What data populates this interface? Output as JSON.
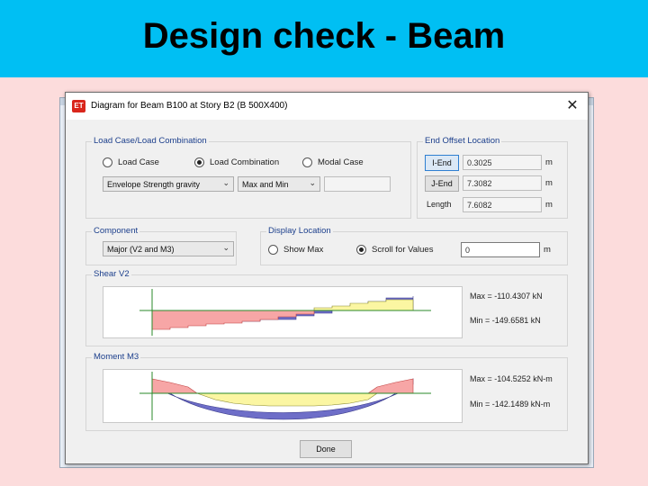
{
  "slide": {
    "title": "Design check - Beam"
  },
  "dialog": {
    "title": "Diagram for Beam B100 at Story B2 (B 500X400)",
    "load_case_group": {
      "label": "Load Case/Load Combination",
      "radios": [
        {
          "label": "Load Case",
          "selected": false
        },
        {
          "label": "Load Combination",
          "selected": true
        },
        {
          "label": "Modal Case",
          "selected": false
        }
      ],
      "combo_value": "Envelope Strength gravity",
      "type_value": "Max and Min",
      "extra_value": ""
    },
    "end_offset_group": {
      "label": "End Offset Location",
      "i_end": {
        "label": "I-End",
        "value": "0.3025",
        "unit": "m"
      },
      "j_end": {
        "label": "J-End",
        "value": "7.3082",
        "unit": "m"
      },
      "length": {
        "label": "Length",
        "value": "7.6082",
        "unit": "m"
      }
    },
    "component_group": {
      "label": "Component",
      "value": "Major (V2 and M3)"
    },
    "display_location_group": {
      "label": "Display Location",
      "radios": [
        {
          "label": "Show Max",
          "selected": false
        },
        {
          "label": "Scroll for Values",
          "selected": true
        }
      ],
      "value": "0",
      "unit": "m"
    },
    "shear": {
      "label": "Shear V2",
      "max": "Max = -110.4307 kN",
      "min": "Min = -149.6581 kN"
    },
    "moment": {
      "label": "Moment M3",
      "max": "Max = -104.5252 kN-m",
      "min": "Min = -142.1489 kN-m"
    },
    "done_label": "Done"
  },
  "colors": {
    "header": "#00bff3",
    "slide_bg": "#fcdcdc",
    "negative_fill": "#f7a6a6",
    "positive_fill": "#fbf6a2",
    "envelope_fill": "#6e6ec8",
    "axis": "#2a8a2a"
  }
}
